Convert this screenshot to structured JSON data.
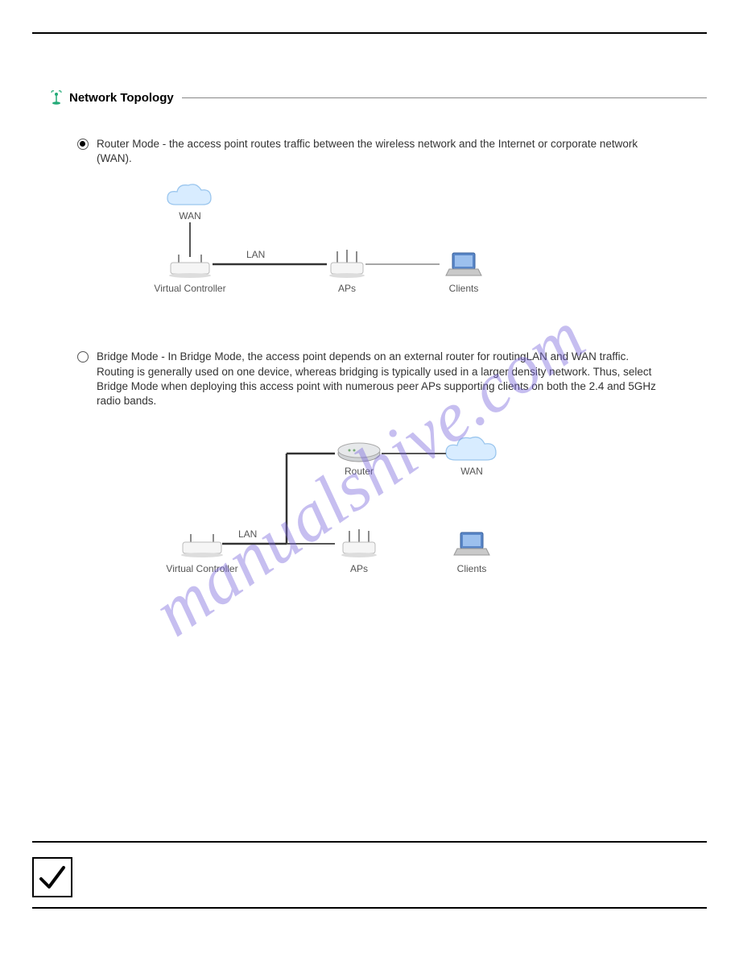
{
  "section": {
    "title": "Network Topology"
  },
  "options": {
    "router": {
      "text": "Router Mode - the access point routes traffic between the wireless network and the Internet or corporate network (WAN)."
    },
    "bridge": {
      "text": "Bridge Mode - In Bridge Mode, the access point depends on an external router for routingLAN and WAN traffic. Routing is generally used on one device, whereas bridging is typically used in a larger density network. Thus, select Bridge Mode when deploying this access point with numerous peer APs supporting clients on both the 2.4 and 5GHz radio bands."
    }
  },
  "diagram1": {
    "wan": "WAN",
    "lan": "LAN",
    "vc": "Virtual Controller",
    "aps": "APs",
    "clients": "Clients"
  },
  "diagram2": {
    "lan": "LAN",
    "vc": "Virtual Controller",
    "aps": "APs",
    "clients": "Clients",
    "router": "Router",
    "wan": "WAN"
  },
  "watermark": "manualshive.com"
}
